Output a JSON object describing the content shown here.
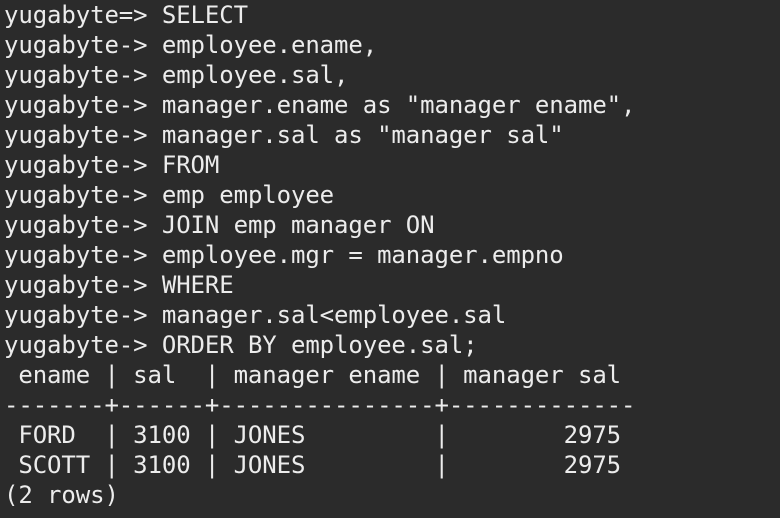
{
  "terminal": {
    "lines": [
      {
        "prompt": "yugabyte=> ",
        "text": "SELECT"
      },
      {
        "prompt": "yugabyte-> ",
        "text": "employee.ename,"
      },
      {
        "prompt": "yugabyte-> ",
        "text": "employee.sal,"
      },
      {
        "prompt": "yugabyte-> ",
        "text": "manager.ename as \"manager ename\","
      },
      {
        "prompt": "yugabyte-> ",
        "text": "manager.sal as \"manager sal\""
      },
      {
        "prompt": "yugabyte-> ",
        "text": "FROM"
      },
      {
        "prompt": "yugabyte-> ",
        "text": "emp employee"
      },
      {
        "prompt": "yugabyte-> ",
        "text": "JOIN emp manager ON"
      },
      {
        "prompt": "yugabyte-> ",
        "text": "employee.mgr = manager.empno"
      },
      {
        "prompt": "yugabyte-> ",
        "text": "WHERE"
      },
      {
        "prompt": "yugabyte-> ",
        "text": "manager.sal<employee.sal"
      },
      {
        "prompt": "yugabyte-> ",
        "text": "ORDER BY employee.sal;"
      }
    ],
    "result": {
      "header": " ename | sal  | manager ename | manager sal ",
      "separator": "-------+------+---------------+-------------",
      "rows": [
        " FORD  | 3100 | JONES         |        2975",
        " SCOTT | 3100 | JONES         |        2975"
      ],
      "footer": "(2 rows)"
    }
  }
}
